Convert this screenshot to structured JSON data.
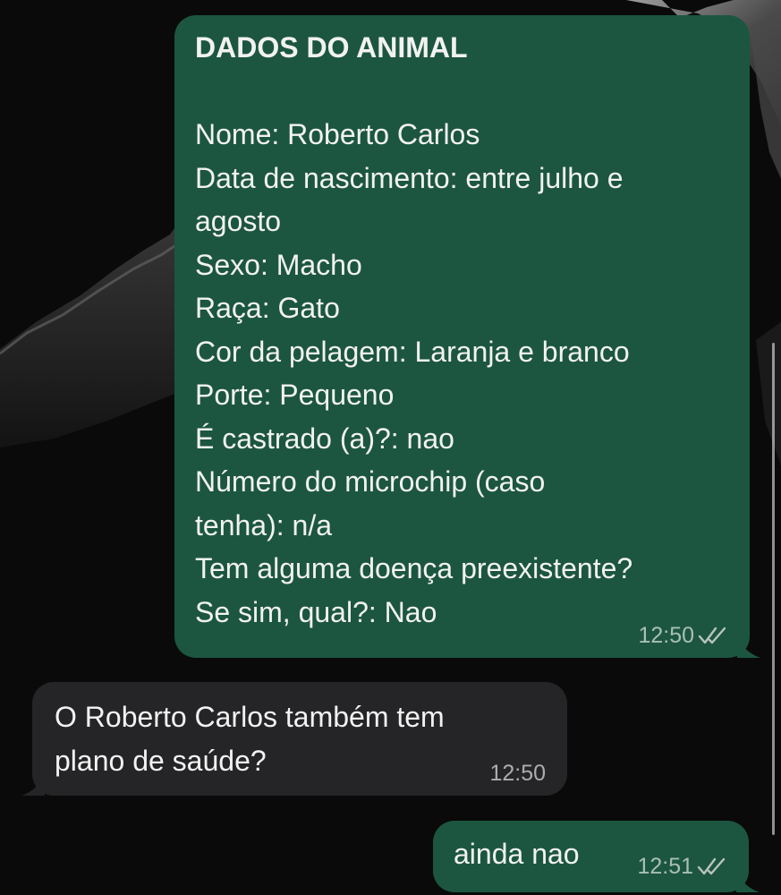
{
  "chat": {
    "messages": [
      {
        "direction": "outgoing",
        "title": "DADOS DO ANIMAL",
        "lines": [
          "Nome: Roberto Carlos",
          "Data de nascimento: entre julho e",
          "agosto",
          "Sexo: Macho",
          "Raça: Gato",
          "Cor da pelagem: Laranja e branco",
          "Porte: Pequeno",
          "É castrado (a)?: nao",
          "Número do microchip (caso",
          "tenha): n/a",
          "Tem alguma doença preexistente?",
          "Se sim, qual?: Nao"
        ],
        "time": "12:50",
        "status": "read"
      },
      {
        "direction": "incoming",
        "lines": [
          "O Roberto Carlos também tem",
          "plano de saúde?"
        ],
        "time": "12:50"
      },
      {
        "direction": "outgoing",
        "text": "ainda nao",
        "time": "12:51",
        "status": "read"
      }
    ]
  },
  "icons": {
    "read_status": "double-check-icon"
  },
  "colors": {
    "background": "#0a0a0a",
    "outgoing_bubble": "#1c5640",
    "incoming_bubble": "#252527",
    "text": "#f2f2f2",
    "meta_text": "#9fb0a8"
  }
}
